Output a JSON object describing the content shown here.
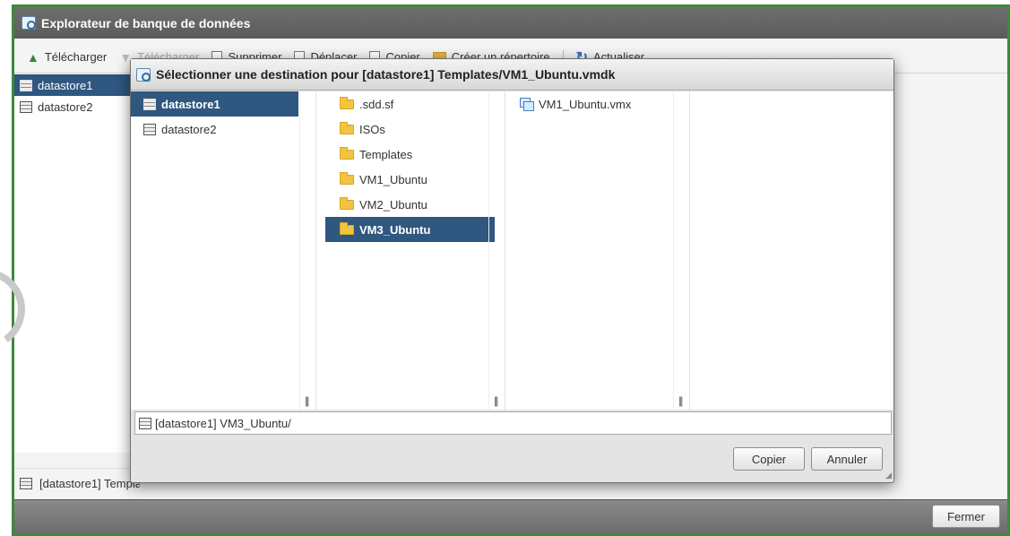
{
  "window": {
    "title": "Explorateur de banque de données"
  },
  "toolbar": {
    "upload": "Télécharger",
    "download": "Télécharger",
    "delete": "Supprimer",
    "move": "Déplacer",
    "copy": "Copier",
    "mkdir": "Créer un répertoire",
    "refresh": "Actualiser"
  },
  "tree": {
    "items": [
      {
        "label": "datastore1",
        "selected": true
      },
      {
        "label": "datastore2",
        "selected": false
      }
    ]
  },
  "status_path": "[datastore1] Templates/VM1_Ubuntu.vmdk",
  "footer": {
    "close_label": "Fermer"
  },
  "dialog": {
    "title": "Sélectionner une destination pour [datastore1] Templates/VM1_Ubuntu.vmdk",
    "datastores": [
      {
        "label": "datastore1",
        "selected": true
      },
      {
        "label": "datastore2",
        "selected": false
      }
    ],
    "folders": [
      {
        "label": ".sdd.sf",
        "selected": false
      },
      {
        "label": "ISOs",
        "selected": false
      },
      {
        "label": "Templates",
        "selected": false
      },
      {
        "label": "VM1_Ubuntu",
        "selected": false
      },
      {
        "label": "VM2_Ubuntu",
        "selected": false
      },
      {
        "label": "VM3_Ubuntu",
        "selected": true
      }
    ],
    "files": [
      {
        "label": "VM1_Ubuntu.vmx",
        "icon": "vm-config-icon"
      }
    ],
    "path_value": "[datastore1] VM3_Ubuntu/",
    "copy_label": "Copier",
    "cancel_label": "Annuler"
  },
  "colors": {
    "frame_border": "#3c8a3c",
    "selection": "#2f5780",
    "title_bar": "#5b5b5b"
  }
}
